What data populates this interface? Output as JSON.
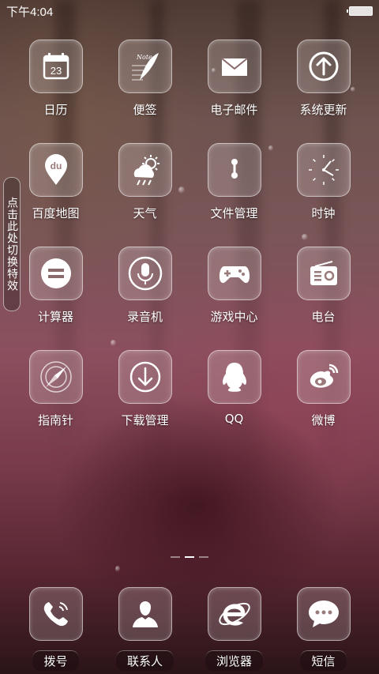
{
  "status_bar": {
    "time": "下午4:04",
    "battery_level": 1.0
  },
  "side_tab": {
    "text": "点击此处切换特效"
  },
  "apps": [
    {
      "label": "日历",
      "icon": "calendar-icon",
      "icon_text": "23"
    },
    {
      "label": "便签",
      "icon": "notes-quill-icon",
      "icon_text": "Note"
    },
    {
      "label": "电子邮件",
      "icon": "envelope-icon"
    },
    {
      "label": "系统更新",
      "icon": "up-arrow-icon"
    },
    {
      "label": "百度地图",
      "icon": "map-pin-icon",
      "icon_text": "du"
    },
    {
      "label": "天气",
      "icon": "weather-icon"
    },
    {
      "label": "文件管理",
      "icon": "file-manager-icon"
    },
    {
      "label": "时钟",
      "icon": "clock-icon"
    },
    {
      "label": "计算器",
      "icon": "calculator-icon"
    },
    {
      "label": "录音机",
      "icon": "microphone-icon"
    },
    {
      "label": "游戏中心",
      "icon": "gamepad-icon"
    },
    {
      "label": "电台",
      "icon": "radio-icon"
    },
    {
      "label": "指南针",
      "icon": "compass-icon"
    },
    {
      "label": "下载管理",
      "icon": "download-icon"
    },
    {
      "label": "QQ",
      "icon": "penguin-icon"
    },
    {
      "label": "微博",
      "icon": "weibo-icon"
    }
  ],
  "page_indicator": {
    "count": 3,
    "active": 2
  },
  "dock": [
    {
      "label": "拨号",
      "icon": "phone-icon"
    },
    {
      "label": "联系人",
      "icon": "contact-icon"
    },
    {
      "label": "浏览器",
      "icon": "browser-e-icon"
    },
    {
      "label": "短信",
      "icon": "message-bubble-icon"
    }
  ]
}
